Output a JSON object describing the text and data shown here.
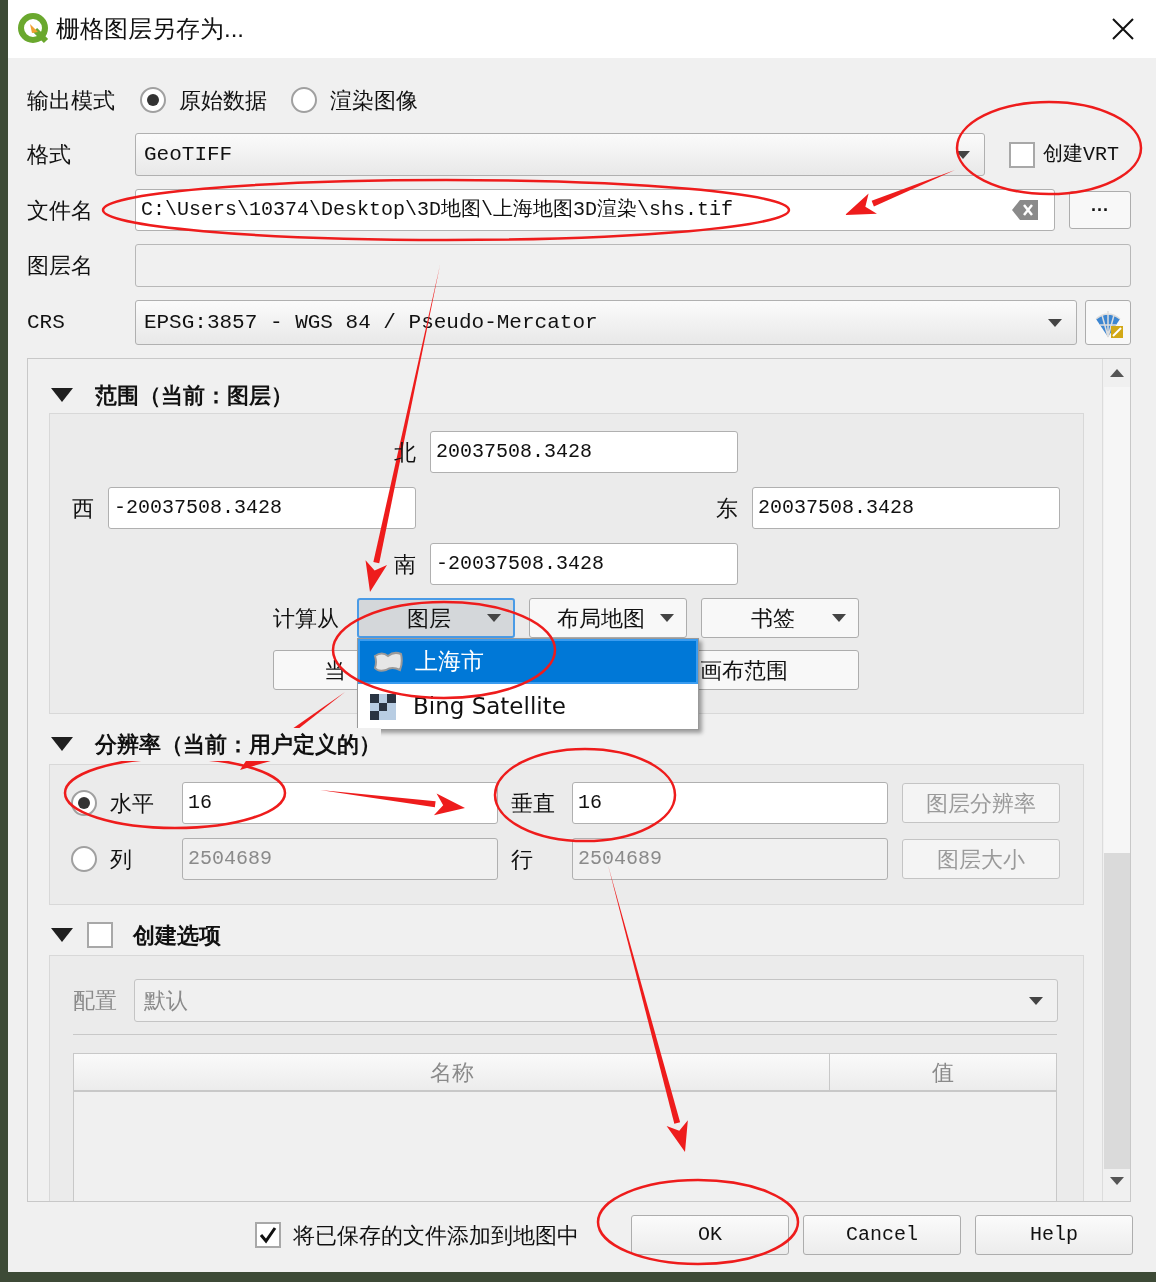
{
  "window": {
    "title": "栅格图层另存为..."
  },
  "output_mode": {
    "label": "输出模式",
    "options": [
      {
        "label": "原始数据",
        "selected": true
      },
      {
        "label": "渲染图像",
        "selected": false
      }
    ]
  },
  "format": {
    "label": "格式",
    "value": "GeoTIFF",
    "create_vrt": {
      "label": "创建VRT",
      "checked": false
    }
  },
  "file_name": {
    "label": "文件名",
    "value": "C:\\Users\\10374\\Desktop\\3D地图\\上海地图3D渲染\\shs.tif",
    "browse_button": "···"
  },
  "layer_name": {
    "label": "图层名"
  },
  "crs": {
    "label": "CRS",
    "value": "EPSG:3857 - WGS 84 / Pseudo-Mercator"
  },
  "extent": {
    "title": "范围（当前：图层）",
    "north": {
      "label": "北",
      "value": "20037508.3428"
    },
    "west": {
      "label": "西",
      "value": "-20037508.3428"
    },
    "east": {
      "label": "东",
      "value": "20037508.3428"
    },
    "south": {
      "label": "南",
      "value": "-20037508.3428"
    },
    "calculate_from": {
      "label": "计算从",
      "buttons": [
        {
          "label": "图层",
          "open": true
        },
        {
          "label": "布局地图",
          "open": false
        },
        {
          "label": "书签",
          "open": false
        }
      ]
    },
    "buttons": [
      "当",
      "画布范围"
    ],
    "layer_menu": [
      {
        "label": "上海市",
        "kind": "vector",
        "selected": true
      },
      {
        "label": "Bing Satellite",
        "kind": "raster",
        "selected": false
      }
    ]
  },
  "resolution": {
    "title": "分辨率（当前：用户定义的）",
    "rows": [
      {
        "label": "水平",
        "selected": true,
        "value": "16",
        "label2": "垂直",
        "value2": "16",
        "disabled": false,
        "button": {
          "label": "图层分辨率",
          "disabled": true
        }
      },
      {
        "label": "列",
        "selected": false,
        "value": "2504689",
        "label2": "行",
        "value2": "2504689",
        "disabled": true,
        "button": {
          "label": "图层大小",
          "disabled": true
        }
      }
    ]
  },
  "creation_options": {
    "title": "创建选项",
    "checked": false,
    "profile": {
      "label": "配置",
      "value": "默认",
      "disabled": true
    },
    "table": {
      "columns": [
        "名称",
        "值"
      ]
    }
  },
  "add_to_map": {
    "label": "将已保存的文件添加到地图中",
    "checked": true
  },
  "buttons": [
    "OK",
    "Cancel",
    "Help"
  ]
}
